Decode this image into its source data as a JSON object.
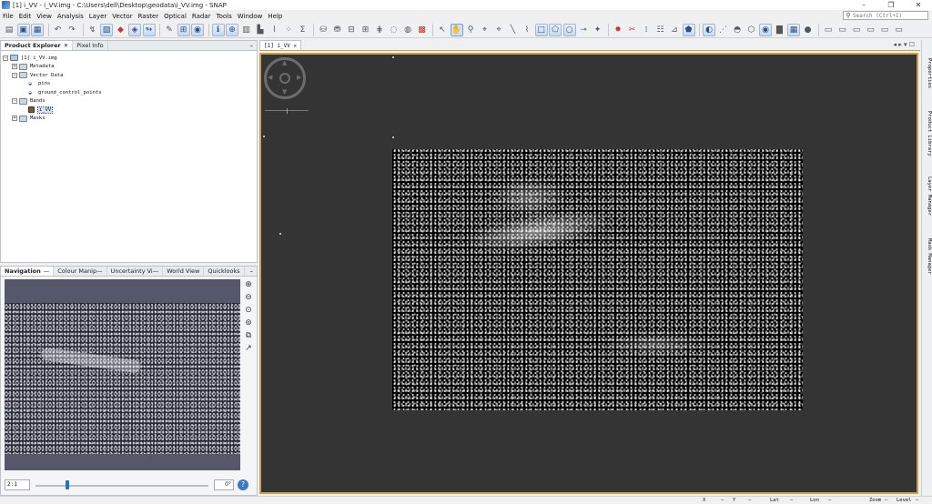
{
  "window": {
    "title": "[1] i_VV - i_VV.img - C:\\Users\\dell\\Desktop\\geodata\\i_VV.img - SNAP",
    "controls": [
      "–",
      "❐",
      "✕"
    ]
  },
  "menu": [
    "File",
    "Edit",
    "View",
    "Analysis",
    "Layer",
    "Vector",
    "Raster",
    "Optical",
    "Radar",
    "Tools",
    "Window",
    "Help"
  ],
  "search": {
    "placeholder": "Search (Ctrl+I)"
  },
  "left_panel": {
    "tabs": [
      {
        "label": "Product Explorer",
        "close": "✕"
      },
      {
        "label": "Pixel Info"
      }
    ],
    "minimize": "–",
    "tree": {
      "product": "[1] i_VV.img",
      "metadata": "Metadata",
      "vector_data": "Vector Data",
      "pins": "pins",
      "gcp": "ground_control_points",
      "bands": "Bands",
      "band_i_vv": "i_VV",
      "masks": "Masks"
    }
  },
  "nav_panel": {
    "tabs": [
      "Navigation",
      "Colour Manip—",
      "Uncertainty Vi—",
      "World View",
      "Quicklooks"
    ],
    "zoom_value": "2:1",
    "angle_value": "0°",
    "slider_fraction": 0.18
  },
  "image_window": {
    "tab": "[1] i_VV",
    "controls": "◂ ▸ ▾ ☐"
  },
  "right_tabs": [
    "Properties",
    "Product Library",
    "Layer Manager",
    "Mask Manager"
  ],
  "status": {
    "x": "X",
    "y": "Y",
    "lat": "Lat",
    "lon": "Lon",
    "zoom": "Zoom",
    "level": "Level"
  }
}
